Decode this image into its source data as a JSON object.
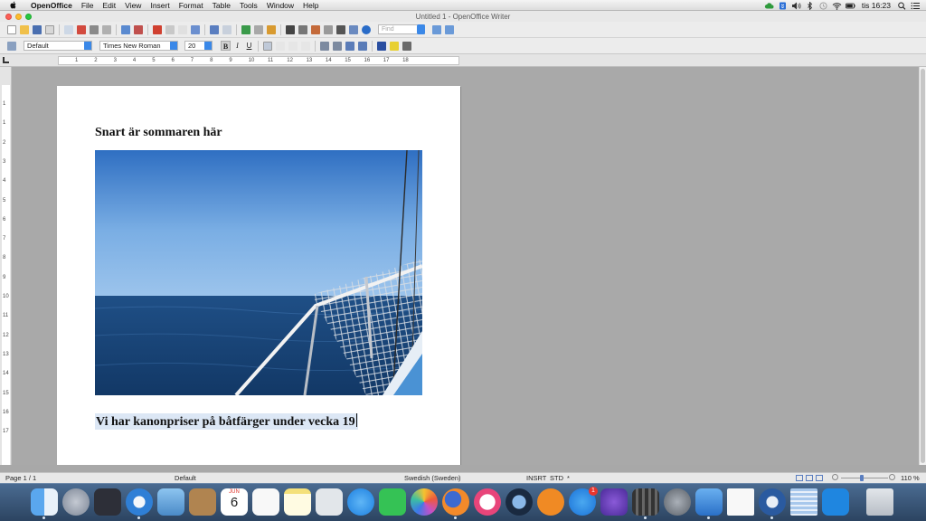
{
  "menubar": {
    "app_name": "OpenOffice",
    "items": [
      "File",
      "Edit",
      "View",
      "Insert",
      "Format",
      "Table",
      "Tools",
      "Window",
      "Help"
    ],
    "clock": "tis 16:23",
    "status_icons": [
      "cloud-icon",
      "dropbox-icon",
      "volume-icon",
      "bluetooth-icon",
      "time-machine-icon",
      "wifi-icon",
      "battery-icon",
      "search-icon",
      "list-icon"
    ]
  },
  "window": {
    "title": "Untitled 1 - OpenOffice Writer"
  },
  "toolbar": {
    "find_placeholder": "Find",
    "paragraph_style": "Default",
    "font_name": "Times New Roman",
    "font_size": "20",
    "bold_label": "B",
    "italic_label": "I",
    "underline_label": "U"
  },
  "document": {
    "heading": "Snart är sommaren här",
    "subline": "Vi har kanonpriser på båtfärger under vecka 19",
    "image_description_icon": "sailboat-sea-photo"
  },
  "ruler": {
    "h_labels": [
      "1",
      "2",
      "3",
      "4",
      "5",
      "6",
      "7",
      "8",
      "9",
      "10",
      "11",
      "12",
      "13",
      "14",
      "15",
      "16",
      "17",
      "18"
    ],
    "v_labels": [
      "1",
      "1",
      "2",
      "3",
      "4",
      "5",
      "6",
      "7",
      "8",
      "9",
      "10",
      "11",
      "12",
      "13",
      "14",
      "15",
      "16",
      "17"
    ]
  },
  "statusbar": {
    "page": "Page 1 / 1",
    "page_style": "Default",
    "language": "Swedish (Sweden)",
    "insert_mode": "INSRT",
    "selection_mode": "STD",
    "modified": "*",
    "zoom": "110 %"
  },
  "dock": {
    "apps": [
      "Finder",
      "Launchpad",
      "Mission Control",
      "Safari",
      "Preview",
      "Contacts",
      "Calendar",
      "Reminders",
      "Notes",
      "Photo Booth",
      "Messages",
      "FaceTime",
      "Photos",
      "Firefox",
      "iTunes",
      "QuickTime",
      "iBooks",
      "App Store",
      "iMovie Theater",
      "iMovie",
      "System Preferences",
      "OpenOffice",
      "Document",
      "Thunderbird",
      "Text",
      "TeamViewer",
      "Trash"
    ],
    "calendar_day": "6",
    "calendar_month": "JUN",
    "appstore_badge": "1"
  },
  "colors": {
    "accent": "#3a88e8",
    "selection": "#dce7f5",
    "canvas": "#a9a9a9",
    "dock_top": "#4a6b91"
  }
}
